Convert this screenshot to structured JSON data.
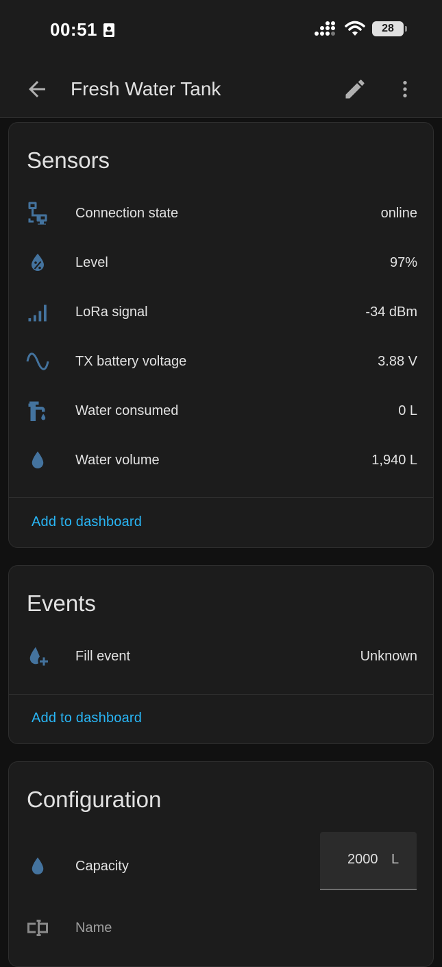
{
  "status": {
    "time": "00:51",
    "battery": "28"
  },
  "appbar": {
    "title": "Fresh Water Tank"
  },
  "sensors": {
    "title": "Sensors",
    "rows": [
      {
        "label": "Connection state",
        "value": "online",
        "icon": "lan-connect-icon"
      },
      {
        "label": "Level",
        "value": "97%",
        "icon": "water-percent-icon"
      },
      {
        "label": "LoRa signal",
        "value": "-34 dBm",
        "icon": "signal-cellular-icon"
      },
      {
        "label": "TX battery voltage",
        "value": "3.88 V",
        "icon": "sine-wave-icon"
      },
      {
        "label": "Water consumed",
        "value": "0 L",
        "icon": "water-pump-icon"
      },
      {
        "label": "Water volume",
        "value": "1,940 L",
        "icon": "water-drop-icon"
      }
    ],
    "action": "Add to dashboard"
  },
  "events": {
    "title": "Events",
    "rows": [
      {
        "label": "Fill event",
        "value": "Unknown",
        "icon": "water-plus-icon"
      }
    ],
    "action": "Add to dashboard"
  },
  "configuration": {
    "title": "Configuration",
    "capacity": {
      "label": "Capacity",
      "value": "2000",
      "unit": "L"
    },
    "name": {
      "label": "Name"
    }
  },
  "colors": {
    "icon": "#44739e",
    "accent": "#29b6f6",
    "card": "#1c1c1c",
    "background": "#111111"
  }
}
